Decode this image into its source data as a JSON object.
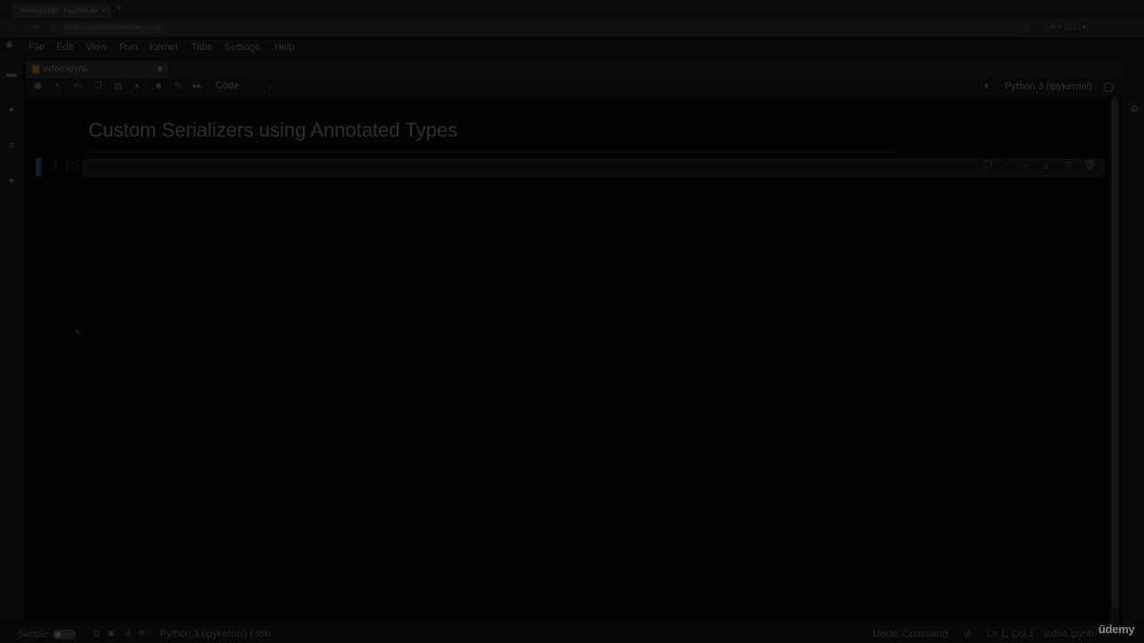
{
  "browser": {
    "tab_title": "video.ipynb - JupyterLab",
    "tab_close": "×",
    "new_tab": "+",
    "address": "localhost:8888/lab/tree/video.ipynb",
    "nav_icons": [
      "←",
      "→",
      "⟳"
    ]
  },
  "menubar": {
    "items": [
      "File",
      "Edit",
      "View",
      "Run",
      "Kernel",
      "Tabs",
      "Settings",
      "Help"
    ]
  },
  "doc_tab": {
    "label": "video.ipynb"
  },
  "toolbar": {
    "icons": [
      "save-icon",
      "add-cell-icon",
      "cut-icon",
      "copy-icon",
      "paste-icon",
      "run-icon",
      "stop-icon",
      "restart-icon",
      "fast-forward-icon"
    ],
    "glyphs": [
      "▣",
      "+",
      "✂",
      "❐",
      "▤",
      "▸",
      "■",
      "↻",
      "▸▸"
    ],
    "cell_type": "Code",
    "caret": "⌄",
    "kernel_name": "Python 3 (ipykernel)",
    "bell": "🔔"
  },
  "notebook": {
    "title": "Custom Serializers using Annotated Types",
    "prompt": "[ ]:",
    "cell_tools": [
      "❐",
      "↑",
      "↓",
      "⤓",
      "⊤",
      "🗑"
    ]
  },
  "statusbar": {
    "mode_label": "Simple",
    "count_a": "0",
    "count_b": "4",
    "kernel_status": "Python 3 (ipykernel) | Idle",
    "mode": "Mode: Command",
    "position": "Ln 1, Col 1",
    "filename": "video.ipynb"
  },
  "watermark": "ūdemy"
}
